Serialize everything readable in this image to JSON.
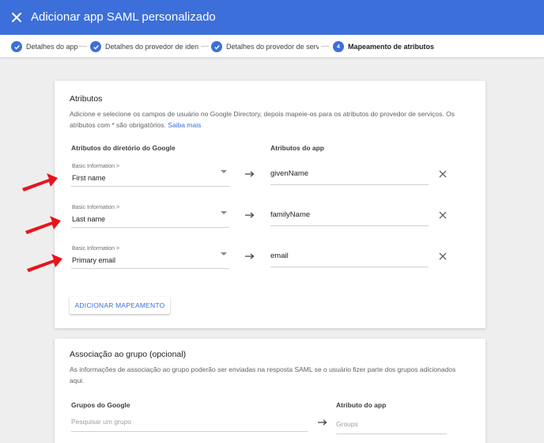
{
  "header": {
    "title": "Adicionar app SAML personalizado",
    "close_icon": "close-icon",
    "bg_color": "#3c6fd9"
  },
  "stepper": {
    "steps": [
      {
        "label": "Detalhes do app",
        "state": "done"
      },
      {
        "label": "Detalhes do provedor de identi",
        "state": "done"
      },
      {
        "label": "Detalhes do provedor de serviç",
        "state": "done"
      },
      {
        "label": "Mapeamento de atributos",
        "state": "active",
        "number": "4"
      }
    ]
  },
  "attributes": {
    "title": "Atributos",
    "description": "Adicione e selecione os campos de usuário no Google Directory, depois mapeie-os para os atributos do provedor de serviços. Os atributos com * são obrigatórios.",
    "learn_more": "Saiba mais",
    "col_google": "Atributos do diretório do Google",
    "col_app": "Atributos do app",
    "mappings": [
      {
        "category": "Basic Information >",
        "field": "First name",
        "app_attr": "givenName"
      },
      {
        "category": "Basic Information >",
        "field": "Last name",
        "app_attr": "familyName"
      },
      {
        "category": "Basic Information >",
        "field": "Primary email",
        "app_attr": "email"
      }
    ],
    "add_button": "ADICIONAR MAPEAMENTO"
  },
  "group": {
    "title": "Associação ao grupo (opcional)",
    "description": "As informações de associação ao grupo poderão ser enviadas na resposta SAML se o usuário fizer parte dos grupos adicionados aqui.",
    "col_google": "Grupos do Google",
    "col_app": "Atributo do app",
    "search_placeholder": "Pesquisar um grupo",
    "app_placeholder": "Groups"
  },
  "annotation_color": "#e8141b"
}
